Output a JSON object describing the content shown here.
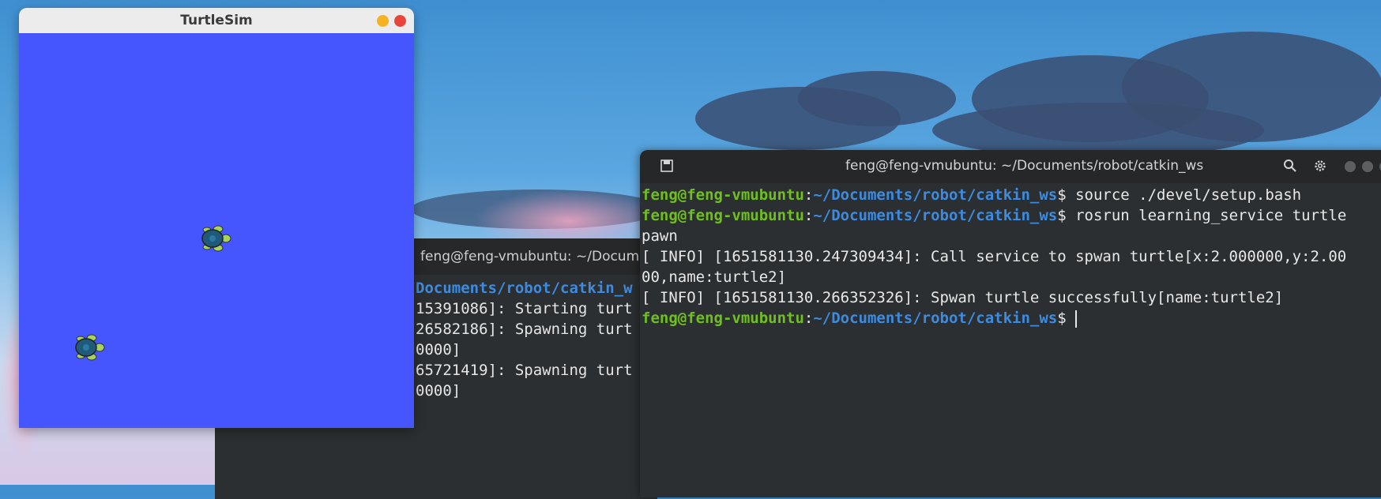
{
  "turtlesim": {
    "title": "TurtleSim"
  },
  "back_terminal": {
    "title": "feng@feng-vmubuntu: ~/Docume",
    "lines": [
      "Documents/robot/catkin_w",
      "15391086]: Starting turt",
      "26582186]: Spawning turt",
      "0000]",
      "65721419]: Spawning turt",
      "0000]"
    ]
  },
  "front_terminal": {
    "title": "feng@feng-vmubuntu: ~/Documents/robot/catkin_ws",
    "prompt_user": "feng@feng-vmubuntu",
    "prompt_path": "~/Documents/robot/catkin_ws",
    "line1_cmd": " source ./devel/setup.bash",
    "line2_cmd": " rosrun learning_service turtle",
    "line3": "pawn",
    "line4": "[ INFO] [1651581130.247309434]: Call service to spwan turtle[x:2.000000,y:2.00",
    "line5": "00,name:turtle2]",
    "line6": "[ INFO] [1651581130.266352326]: Spwan turtle successfully[name:turtle2]",
    "line7_cmd": " "
  },
  "icons": {
    "new_tab": "new-tab-icon",
    "search": "search-icon",
    "settings": "gear-icon"
  }
}
